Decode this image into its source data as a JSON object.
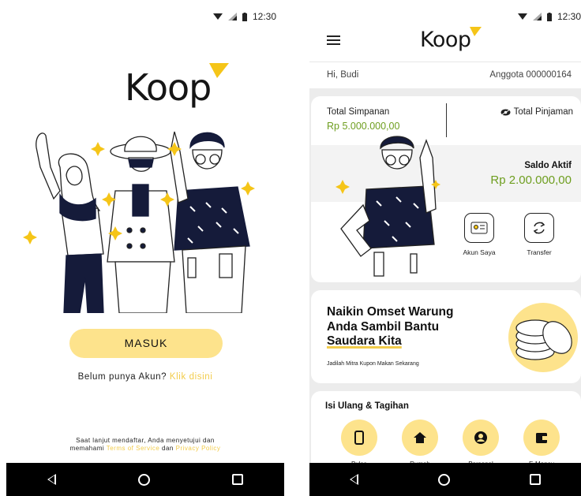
{
  "status": {
    "time": "12:30"
  },
  "login": {
    "logo": "Koop",
    "button": "MASUK",
    "signup_text": "Belum punya Akun?",
    "signup_link": "Klik disini",
    "terms_line1": "Saat lanjut mendaftar, Anda menyetujui dan",
    "terms_pre": "memahami",
    "terms_link": "Terms of Service",
    "terms_and": "dan",
    "privacy_link": "Privacy Policy"
  },
  "home": {
    "logo": "Koop",
    "greeting": "Hi, Budi",
    "member": "Anggota 000000164",
    "total_simpanan_label": "Total Simpanan",
    "total_simpanan_value": "Rp 5.000.000,00",
    "total_pinjaman_label": "Total Pinjaman",
    "saldo_label": "Saldo Aktif",
    "saldo_value": "Rp 2.00.000,00",
    "actions": [
      {
        "label": "Akun Saya",
        "icon": "id-card-icon"
      },
      {
        "label": "Transfer",
        "icon": "transfer-icon"
      }
    ],
    "promo_line1": "Naikin Omset Warung",
    "promo_line2": "Anda Sambil Bantu",
    "promo_line3": "Saudara Kita",
    "promo_sub": "Jadilah Mitra Kupon Makan Sekarang",
    "bills_title": "Isi Ulang & Tagihan",
    "bills": [
      {
        "label": "Pulsa",
        "icon": "phone-icon"
      },
      {
        "label": "Rumah",
        "icon": "home-icon"
      },
      {
        "label": "Personal",
        "icon": "person-icon"
      },
      {
        "label": "E-Money",
        "icon": "wallet-icon"
      }
    ]
  },
  "colors": {
    "accent": "#fde38c",
    "link": "#f2cc4b",
    "money": "#6e9e1f"
  }
}
